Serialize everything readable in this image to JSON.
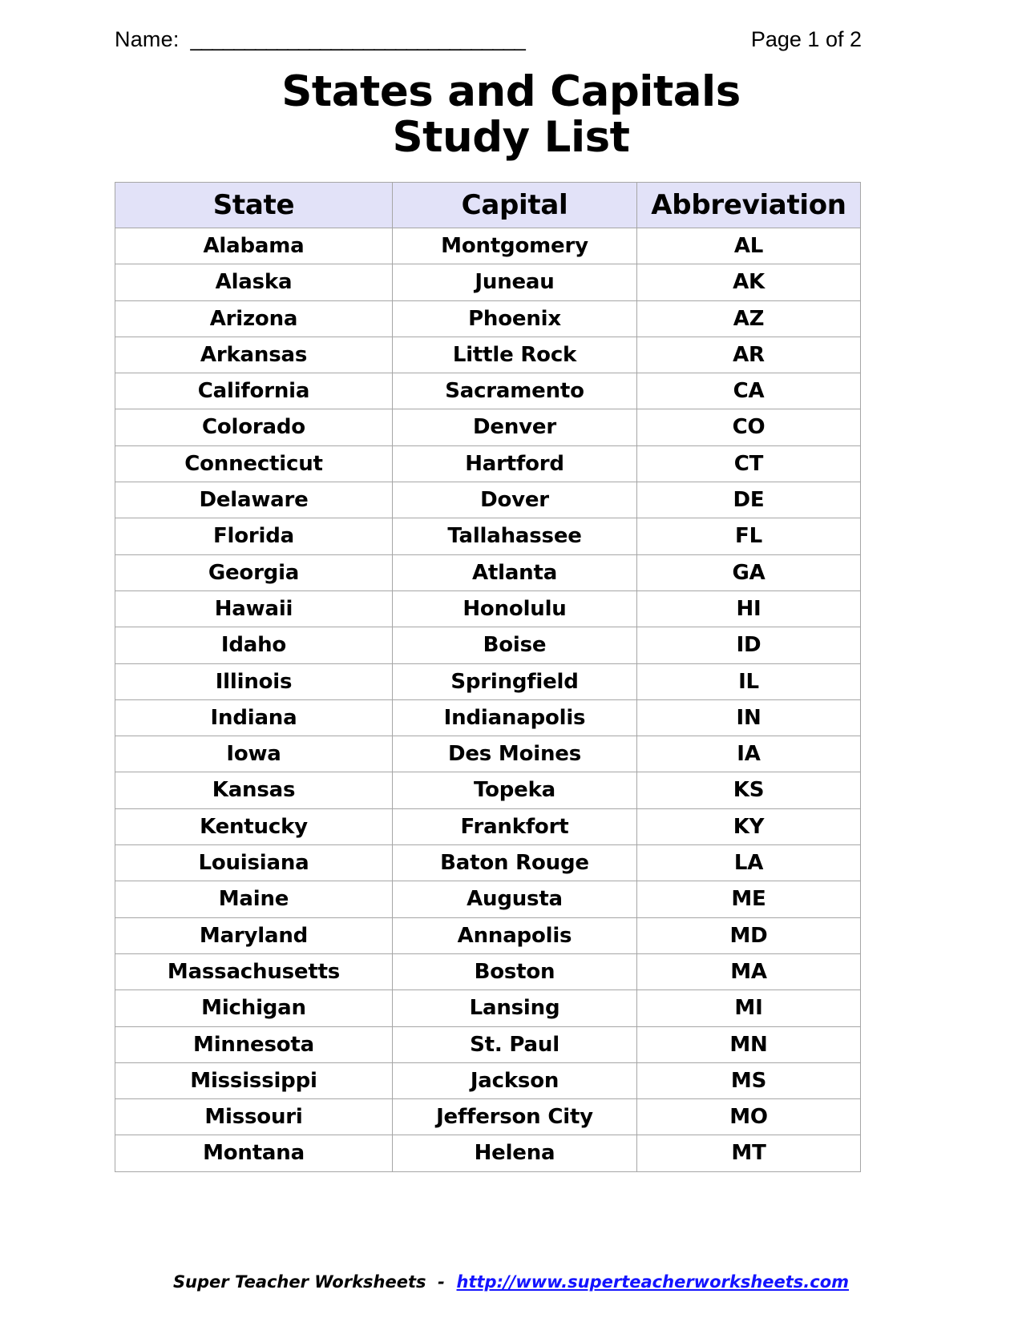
{
  "header": {
    "name_label": "Name:",
    "name_blank": "_______________________________",
    "page_number": "Page 1 of 2"
  },
  "title": {
    "line1": "States and Capitals",
    "line2": "Study List"
  },
  "table": {
    "columns": [
      "State",
      "Capital",
      "Abbreviation"
    ],
    "rows": [
      [
        "Alabama",
        "Montgomery",
        "AL"
      ],
      [
        "Alaska",
        "Juneau",
        "AK"
      ],
      [
        "Arizona",
        "Phoenix",
        "AZ"
      ],
      [
        "Arkansas",
        "Little Rock",
        "AR"
      ],
      [
        "California",
        "Sacramento",
        "CA"
      ],
      [
        "Colorado",
        "Denver",
        "CO"
      ],
      [
        "Connecticut",
        "Hartford",
        "CT"
      ],
      [
        "Delaware",
        "Dover",
        "DE"
      ],
      [
        "Florida",
        "Tallahassee",
        "FL"
      ],
      [
        "Georgia",
        "Atlanta",
        "GA"
      ],
      [
        "Hawaii",
        "Honolulu",
        "HI"
      ],
      [
        "Idaho",
        "Boise",
        "ID"
      ],
      [
        "Illinois",
        "Springfield",
        "IL"
      ],
      [
        "Indiana",
        "Indianapolis",
        "IN"
      ],
      [
        "Iowa",
        "Des Moines",
        "IA"
      ],
      [
        "Kansas",
        "Topeka",
        "KS"
      ],
      [
        "Kentucky",
        "Frankfort",
        "KY"
      ],
      [
        "Louisiana",
        "Baton Rouge",
        "LA"
      ],
      [
        "Maine",
        "Augusta",
        "ME"
      ],
      [
        "Maryland",
        "Annapolis",
        "MD"
      ],
      [
        "Massachusetts",
        "Boston",
        "MA"
      ],
      [
        "Michigan",
        "Lansing",
        "MI"
      ],
      [
        "Minnesota",
        "St. Paul",
        "MN"
      ],
      [
        "Mississippi",
        "Jackson",
        "MS"
      ],
      [
        "Missouri",
        "Jefferson City",
        "MO"
      ],
      [
        "Montana",
        "Helena",
        "MT"
      ]
    ]
  },
  "footer": {
    "brand": "Super Teacher Worksheets",
    "separator": "  -  ",
    "url": "http://www.superteacherworksheets.com"
  },
  "colors": {
    "header_fill": "#e2e2f8",
    "border": "#a6a6a6",
    "link": "#1414ff",
    "text": "#000000"
  }
}
